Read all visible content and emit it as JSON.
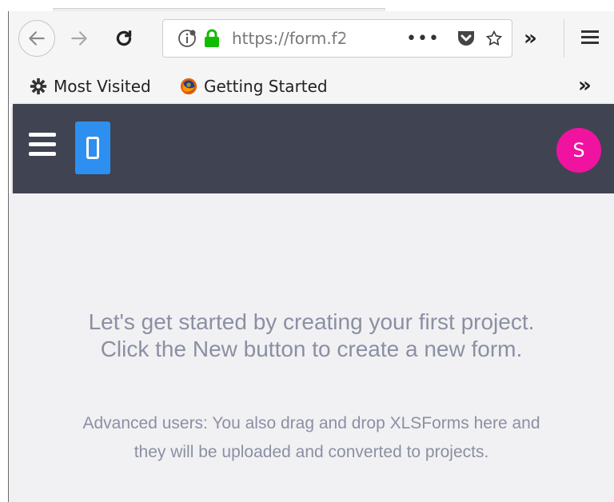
{
  "browser": {
    "url": "https://form.f2",
    "url_dots": "•••",
    "overflow": "»",
    "bookmarks": [
      {
        "label": "Most Visited",
        "icon": "gear-icon"
      },
      {
        "label": "Getting Started",
        "icon": "firefox-icon"
      }
    ],
    "bookmarks_overflow": "»"
  },
  "app": {
    "avatar_initial": "S",
    "colors": {
      "header_bg": "#404352",
      "logo_bg": "#2d8ff0",
      "avatar_bg": "#f013a0",
      "content_bg": "#f1f1f3",
      "text_muted": "#8b8fa3"
    }
  },
  "main": {
    "headline_line1": "Let's get started by creating your first project.",
    "headline_line2": "Click the New button to create a new form.",
    "hint_line1": "Advanced users: You also drag and drop XLSForms here and",
    "hint_line2": "they will be uploaded and converted to projects."
  }
}
